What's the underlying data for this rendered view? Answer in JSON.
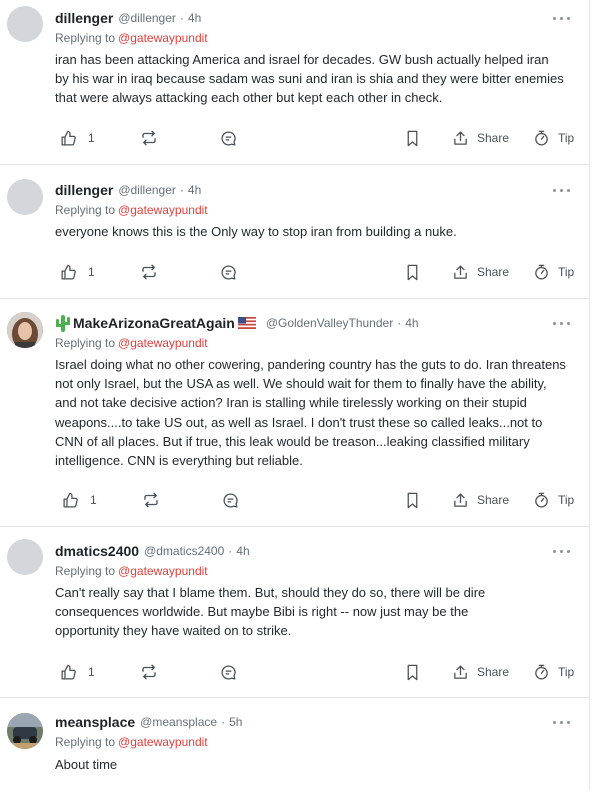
{
  "comments": [
    {
      "author": "dillenger",
      "handle": "@dillenger",
      "time": "4h",
      "replying_label": "Replying to",
      "replying_to": "@gatewaypundit",
      "text": "iran has been attacking America and israel for decades. GW bush actually helped iran by his war in iraq because sadam was suni and iran is shia and they were bitter enemies that were always attacking each other but kept each other in check.",
      "likes": "1",
      "share_label": "Share",
      "tip_label": "Tip"
    },
    {
      "author": "dillenger",
      "handle": "@dillenger",
      "time": "4h",
      "replying_label": "Replying to",
      "replying_to": "@gatewaypundit",
      "text": "everyone knows this is the Only way to stop iran from building a nuke.",
      "likes": "1",
      "share_label": "Share",
      "tip_label": "Tip"
    },
    {
      "author": "MakeArizonaGreatAgain",
      "handle": "@GoldenValleyThunder",
      "time": "4h",
      "replying_label": "Replying to",
      "replying_to": "@gatewaypundit",
      "text": "Israel doing what no other cowering, pandering country has the guts to do. Iran threatens not only Israel, but the USA as well.  We should wait for them to finally have the ability, and not take decisive action? Iran is stalling while tirelessly working on their stupid weapons....to take US out, as well as Israel.  I don't trust these so called leaks...not to CNN of all places. But if true, this leak would be treason...leaking classified military intelligence. CNN is everything but reliable.",
      "likes": "1",
      "share_label": "Share",
      "tip_label": "Tip"
    },
    {
      "author": "dmatics2400",
      "handle": "@dmatics2400",
      "time": "4h",
      "replying_label": "Replying to",
      "replying_to": "@gatewaypundit",
      "text": "Can't really say that I blame them.  But, should they do so, there will be dire consequences worldwide.  But maybe Bibi is right -- now just may be the opportunity they have waited on to strike.",
      "likes": "1",
      "share_label": "Share",
      "tip_label": "Tip"
    },
    {
      "author": "meansplace",
      "handle": "@meansplace",
      "time": "5h",
      "replying_label": "Replying to",
      "replying_to": "@gatewaypundit",
      "text": "About time"
    }
  ],
  "icons": {
    "like": "thumbs-up-icon",
    "repost": "repost-icon",
    "quote": "quote-bubble-icon",
    "bookmark": "bookmark-icon",
    "share": "share-icon",
    "tip": "tip-icon",
    "more": "more-icon",
    "cactus": "cactus-icon",
    "flag": "us-flag-icon"
  },
  "colors": {
    "mention": "#e0403c",
    "muted": "#66707a",
    "text": "#24292f"
  }
}
